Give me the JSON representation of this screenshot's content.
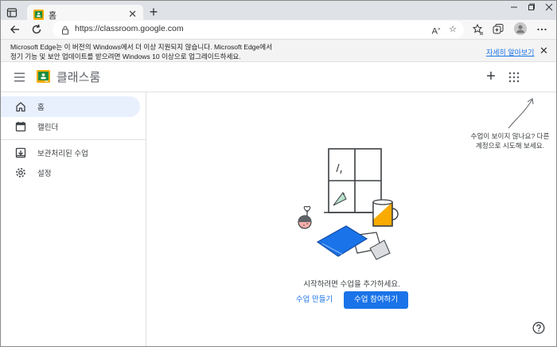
{
  "browser": {
    "tab_title": "홈",
    "url": "https://classroom.google.com",
    "icons": [
      "tab-actions-icon",
      "classroom-favicon",
      "close-icon",
      "plus-icon",
      "minimize-icon",
      "restore-icon",
      "close-window-icon",
      "back-icon",
      "reload-icon",
      "lock-icon",
      "read-aloud-icon",
      "add-favorite-icon",
      "favorites-icon",
      "collections-icon",
      "profile-icon",
      "more-icon"
    ]
  },
  "infobar": {
    "line1": "Microsoft Edge는 이 버전의 Windows에서 더 이상 지원되지 않습니다. Microsoft Edge에서",
    "line2": "정기 기능 및 보안 업데이트를 받으려면 Windows 10 이상으로 업그레이드하세요.",
    "link": "자세히 알아보기"
  },
  "app": {
    "brand": "클래스룸",
    "accent": "#1a73e8",
    "brand_green": "#1e8e3e"
  },
  "sidebar": {
    "items": [
      {
        "label": "홈",
        "icon": "home-icon",
        "active": true
      },
      {
        "label": "캘린더",
        "icon": "calendar-icon",
        "active": false
      },
      {
        "label": "보관처리된 수업",
        "icon": "archive-icon",
        "active": false
      },
      {
        "label": "설정",
        "icon": "settings-icon",
        "active": false
      }
    ]
  },
  "main": {
    "hint_line1": "수업이 보이지 않나요? 다른",
    "hint_line2": "계정으로 시도해 보세요.",
    "empty_message": "시작하려면 수업을 추가하세요.",
    "create_label": "수업 만들기",
    "join_label": "수업 참여하기"
  }
}
